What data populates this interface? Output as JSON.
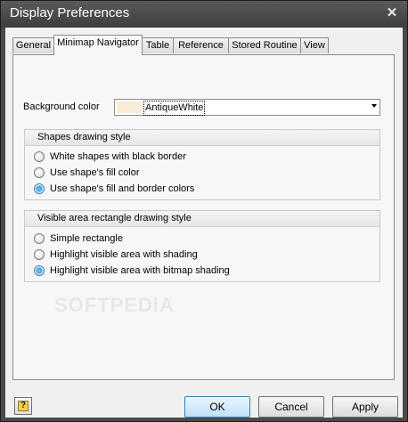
{
  "window": {
    "title": "Display Preferences"
  },
  "tabs": [
    {
      "label": "General"
    },
    {
      "label": "Minimap Navigator"
    },
    {
      "label": "Table"
    },
    {
      "label": "Reference"
    },
    {
      "label": "Stored Routine"
    },
    {
      "label": "View"
    }
  ],
  "background": {
    "label": "Background color",
    "value": "AntiqueWhite",
    "swatch_color": "#FAEBD7"
  },
  "shapes_group": {
    "title": "Shapes drawing style",
    "options": [
      {
        "label": "White shapes with black border",
        "checked": false
      },
      {
        "label": "Use shape's fill color",
        "checked": false
      },
      {
        "label": "Use shape's fill and border colors",
        "checked": true
      }
    ]
  },
  "visible_group": {
    "title": "Visible area rectangle drawing style",
    "options": [
      {
        "label": "Simple rectangle",
        "checked": false
      },
      {
        "label": "Highlight visible area with shading",
        "checked": false
      },
      {
        "label": "Highlight visible area with bitmap shading",
        "checked": true
      }
    ]
  },
  "footer": {
    "help_symbol": "?",
    "ok_label": "OK",
    "cancel_label": "Cancel",
    "apply_label": "Apply"
  },
  "watermark": "SOFTPEDIA"
}
